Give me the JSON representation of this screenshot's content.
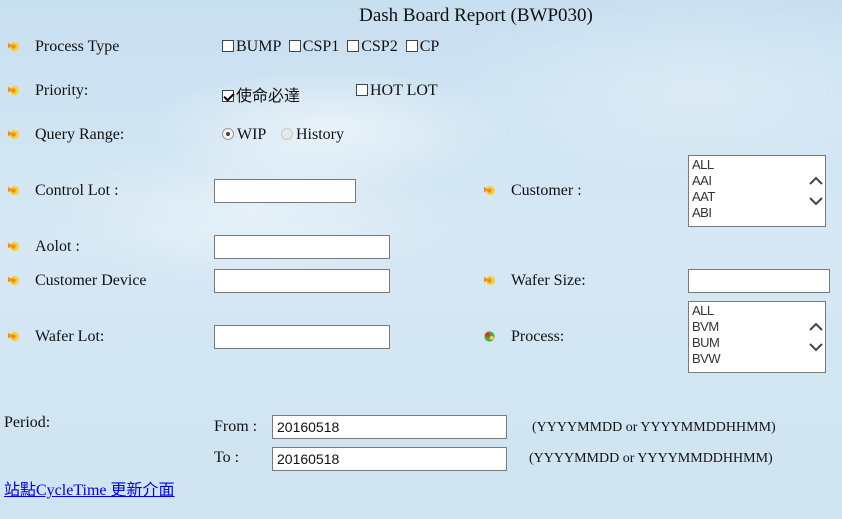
{
  "page": {
    "title": "Dash Board Report (BWP030)"
  },
  "process_type": {
    "label": "Process Type",
    "options": [
      {
        "label": "BUMP",
        "checked": false
      },
      {
        "label": "CSP1",
        "checked": false
      },
      {
        "label": "CSP2",
        "checked": false
      },
      {
        "label": "CP",
        "checked": false
      }
    ]
  },
  "priority": {
    "label": "Priority:",
    "options": [
      {
        "label": "使命必達",
        "checked": true
      },
      {
        "label": "HOT LOT",
        "checked": false
      }
    ]
  },
  "query_range": {
    "label": "Query Range:",
    "options": [
      {
        "label": "WIP",
        "selected": true
      },
      {
        "label": "History",
        "selected": false
      }
    ]
  },
  "control_lot": {
    "label": "Control Lot :",
    "value": ""
  },
  "customer": {
    "label": "Customer :",
    "options": [
      "ALL",
      "AAI",
      "AAT",
      "ABI"
    ]
  },
  "aolot": {
    "label": "Aolot :",
    "value": ""
  },
  "customer_device": {
    "label": "Customer Device",
    "value": ""
  },
  "wafer_size": {
    "label": "Wafer Size:",
    "value": ""
  },
  "wafer_lot": {
    "label": "Wafer Lot:",
    "value": ""
  },
  "process": {
    "label": "Process:",
    "options": [
      "ALL",
      "BVM",
      "BUM",
      "BVW"
    ]
  },
  "period": {
    "label": "Period:",
    "from_label": "From :",
    "from_value": "20160518",
    "to_label": "To :",
    "to_value": "20160518",
    "hint": "(YYYYMMDD or YYYYMMDDHHMM)"
  },
  "link": {
    "label": "站點CycleTime 更新介面"
  },
  "colors": {
    "star_orange": "#f28c1e",
    "star_yellow": "#f6d23a",
    "star_green": "#3cb043",
    "star_red": "#e0302a",
    "link": "#0000ee"
  }
}
